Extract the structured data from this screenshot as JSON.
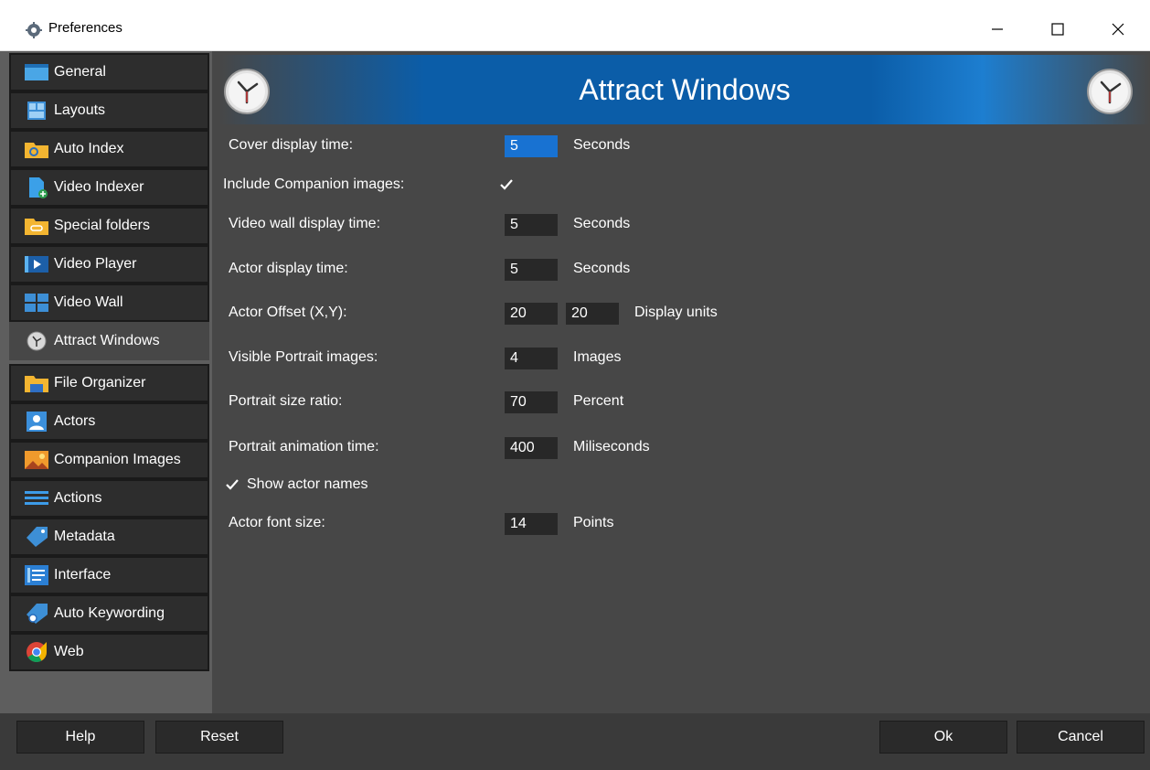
{
  "window": {
    "title": "Preferences"
  },
  "sidebar": {
    "items": [
      {
        "label": "General",
        "icon": "window-icon"
      },
      {
        "label": "Layouts",
        "icon": "layout-icon"
      },
      {
        "label": "Auto Index",
        "icon": "folder-refresh-icon"
      },
      {
        "label": "Video Indexer",
        "icon": "file-add-icon"
      },
      {
        "label": "Special folders",
        "icon": "folder-link-icon"
      },
      {
        "label": "Video Player",
        "icon": "video-player-icon"
      },
      {
        "label": "Video Wall",
        "icon": "video-wall-icon"
      },
      {
        "label": "Attract Windows",
        "icon": "clock-icon",
        "active": true
      },
      {
        "label": "File Organizer",
        "icon": "folder-organize-icon"
      },
      {
        "label": "Actors",
        "icon": "user-icon"
      },
      {
        "label": "Companion Images",
        "icon": "image-icon"
      },
      {
        "label": "Actions",
        "icon": "list-icon"
      },
      {
        "label": "Metadata",
        "icon": "tag-icon"
      },
      {
        "label": "Interface",
        "icon": "interface-icon"
      },
      {
        "label": "Auto Keywording",
        "icon": "tag-refresh-icon"
      },
      {
        "label": "Web",
        "icon": "chrome-icon"
      }
    ]
  },
  "header": {
    "title": "Attract Windows"
  },
  "form": {
    "cover_display": {
      "label": "Cover display time:",
      "value": "5",
      "unit": "Seconds"
    },
    "include_companion": {
      "label": "Include Companion images:",
      "checked": true
    },
    "video_wall_display": {
      "label": "Video wall display time:",
      "value": "5",
      "unit": "Seconds"
    },
    "actor_display": {
      "label": "Actor display time:",
      "value": "5",
      "unit": "Seconds"
    },
    "actor_offset": {
      "label": "Actor Offset (X,Y):",
      "x": "20",
      "y": "20",
      "unit": "Display units"
    },
    "visible_portrait": {
      "label": "Visible Portrait images:",
      "value": "4",
      "unit": "Images"
    },
    "portrait_ratio": {
      "label": "Portrait size ratio:",
      "value": "70",
      "unit": "Percent"
    },
    "portrait_animation": {
      "label": "Portrait animation time:",
      "value": "400",
      "unit": "Miliseconds"
    },
    "show_actor_names": {
      "label": "Show actor names",
      "checked": true
    },
    "actor_font_size": {
      "label": "Actor font size:",
      "value": "14",
      "unit": "Points"
    }
  },
  "footer": {
    "help": "Help",
    "reset": "Reset",
    "ok": "Ok",
    "cancel": "Cancel"
  }
}
